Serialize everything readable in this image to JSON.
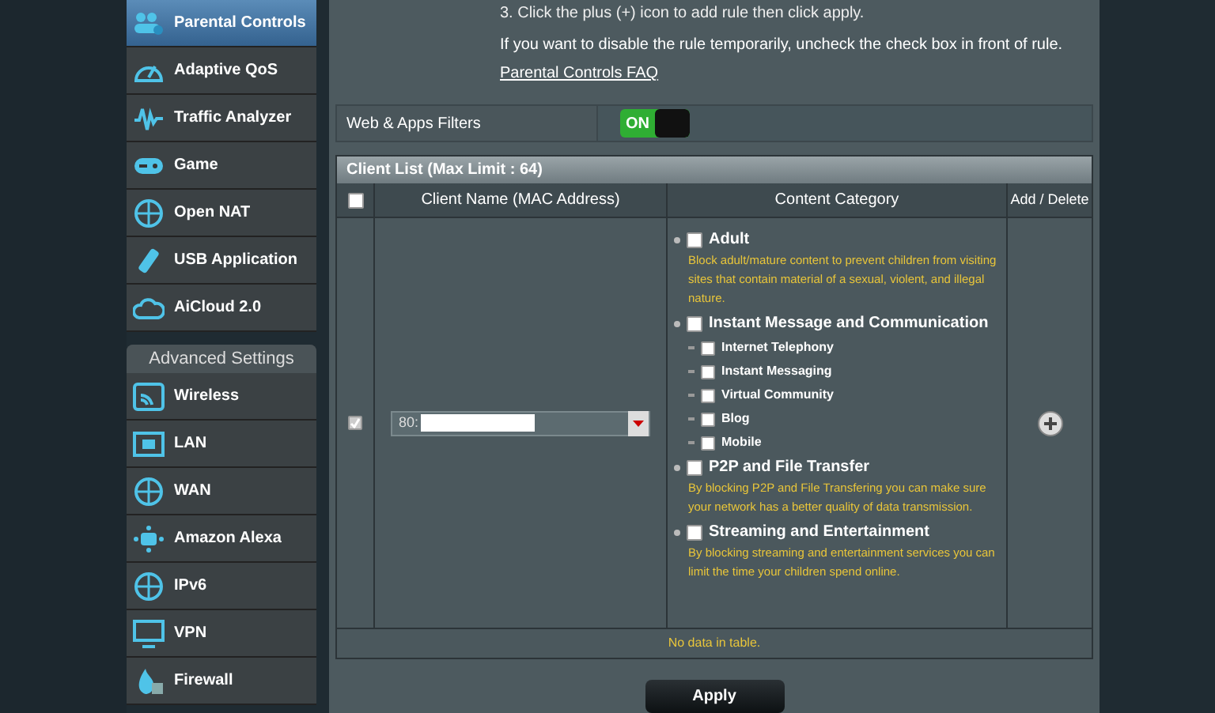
{
  "sidebar": {
    "items": [
      {
        "label": "Parental Controls",
        "selected": true
      },
      {
        "label": "Adaptive QoS",
        "selected": false
      },
      {
        "label": "Traffic Analyzer",
        "selected": false
      },
      {
        "label": "Game",
        "selected": false
      },
      {
        "label": "Open NAT",
        "selected": false
      },
      {
        "label": "USB Application",
        "selected": false
      },
      {
        "label": "AiCloud 2.0",
        "selected": false
      }
    ],
    "advanced_title": "Advanced Settings",
    "advanced_items": [
      {
        "label": "Wireless",
        "selected": false
      },
      {
        "label": "LAN",
        "selected": false
      },
      {
        "label": "WAN",
        "selected": false
      },
      {
        "label": "Amazon Alexa",
        "selected": false
      },
      {
        "label": "IPv6",
        "selected": false
      },
      {
        "label": "VPN",
        "selected": false
      },
      {
        "label": "Firewall",
        "selected": false
      }
    ]
  },
  "intro": {
    "step": "3. Click the plus (+) icon to add rule then click apply.",
    "note": "If you want to disable the rule temporarily, uncheck the check box in front of rule.",
    "faq_link": "Parental Controls FAQ"
  },
  "filter": {
    "label": "Web & Apps Filters",
    "toggle": "ON",
    "on": true
  },
  "client_list": {
    "title": "Client List (Max Limit : 64)",
    "select_all_checked": false,
    "columns": [
      "Client Name (MAC Address)",
      "Content Category",
      "Add / Delete"
    ],
    "row": {
      "checked": true,
      "client": "80:"
    },
    "categories": [
      {
        "label": "Adult",
        "checked": false,
        "description": "Block adult/mature content to prevent children from visiting sites that contain material of a sexual, violent, and illegal nature."
      },
      {
        "label": "Instant Message and Communication",
        "checked": false,
        "children": [
          {
            "label": "Internet Telephony",
            "checked": false
          },
          {
            "label": "Instant Messaging",
            "checked": false
          },
          {
            "label": "Virtual Community",
            "checked": false
          },
          {
            "label": "Blog",
            "checked": false
          },
          {
            "label": "Mobile",
            "checked": false
          }
        ]
      },
      {
        "label": "P2P and File Transfer",
        "checked": false,
        "description": "By blocking P2P and File Transfering you can make sure your network has a better quality of data transmission."
      },
      {
        "label": "Streaming and Entertainment",
        "checked": false,
        "description": "By blocking streaming and entertainment services you can limit the time your children spend online."
      }
    ],
    "empty_message": "No data in table."
  },
  "apply_button": "Apply"
}
